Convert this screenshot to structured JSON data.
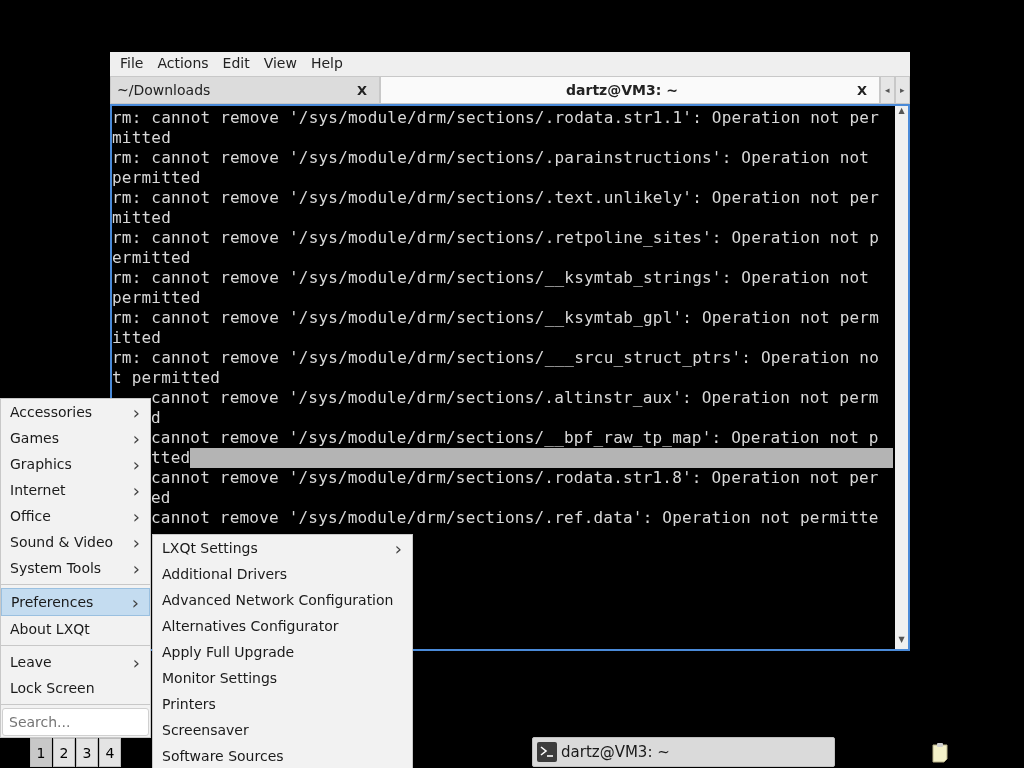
{
  "terminal": {
    "menu_bar": [
      "File",
      "Actions",
      "Edit",
      "View",
      "Help"
    ],
    "tabs": [
      {
        "label": "~/Downloads",
        "close": "X",
        "selected": false
      },
      {
        "label": "dartz@VM3: ~",
        "close": "X",
        "selected": true
      }
    ],
    "tab_scroll": [
      "◂",
      "▸"
    ],
    "lines": [
      {
        "text": "rm: cannot remove '/sys/module/drm/sections/.rodata.str1.1': Operation not per",
        "covered": false
      },
      {
        "text": "mitted",
        "covered": false
      },
      {
        "text": "rm: cannot remove '/sys/module/drm/sections/.parainstructions': Operation not",
        "covered": false
      },
      {
        "text": "permitted",
        "covered": false
      },
      {
        "text": "rm: cannot remove '/sys/module/drm/sections/.text.unlikely': Operation not per",
        "covered": false
      },
      {
        "text": "mitted",
        "covered": false
      },
      {
        "text": "rm: cannot remove '/sys/module/drm/sections/.retpoline_sites': Operation not p",
        "covered": false
      },
      {
        "text": "ermitted",
        "covered": false
      },
      {
        "text": "rm: cannot remove '/sys/module/drm/sections/__ksymtab_strings': Operation not",
        "covered": false
      },
      {
        "text": "permitted",
        "covered": false
      },
      {
        "text": "rm: cannot remove '/sys/module/drm/sections/__ksymtab_gpl': Operation not perm",
        "covered": false
      },
      {
        "text": "itted",
        "covered": false
      },
      {
        "text": "rm: cannot remove '/sys/module/drm/sections/___srcu_struct_ptrs': Operation no",
        "covered": false
      },
      {
        "text": "t permitted",
        "covered": false
      },
      {
        "text": "cannot remove '/sys/module/drm/sections/.altinstr_aux': Operation not perm",
        "covered": true
      },
      {
        "text": "d",
        "covered": true
      },
      {
        "text": "cannot remove '/sys/module/drm/sections/__bpf_raw_tp_map': Operation not p",
        "covered": true
      },
      {
        "text": "tted",
        "covered": true,
        "highlighted": true
      },
      {
        "text": "cannot remove '/sys/module/drm/sections/.rodata.str1.8': Operation not per",
        "covered": true
      },
      {
        "text": "ed",
        "covered": true
      },
      {
        "text": "cannot remove '/sys/module/drm/sections/.ref.data': Operation not permitte",
        "covered": true
      }
    ],
    "scroll_arrows": [
      "▲",
      "▼"
    ]
  },
  "main_menu": {
    "items": [
      {
        "label": "Accessories",
        "submenu": true,
        "selected": false
      },
      {
        "label": "Games",
        "submenu": true,
        "selected": false
      },
      {
        "label": "Graphics",
        "submenu": true,
        "selected": false
      },
      {
        "label": "Internet",
        "submenu": true,
        "selected": false
      },
      {
        "label": "Office",
        "submenu": true,
        "selected": false
      },
      {
        "label": "Sound & Video",
        "submenu": true,
        "selected": false
      },
      {
        "label": "System Tools",
        "submenu": true,
        "selected": false,
        "separator_after": true
      },
      {
        "label": "Preferences",
        "submenu": true,
        "selected": true
      },
      {
        "label": "About LXQt",
        "submenu": false,
        "selected": false,
        "separator_after": true
      },
      {
        "label": "Leave",
        "submenu": true,
        "selected": false
      },
      {
        "label": "Lock Screen",
        "submenu": false,
        "selected": false,
        "separator_after": true
      }
    ],
    "arrow": "›",
    "search": {
      "placeholder": "Search..."
    }
  },
  "submenu": {
    "items": [
      {
        "label": "LXQt Settings",
        "submenu": true
      },
      {
        "label": "Additional Drivers",
        "submenu": false
      },
      {
        "label": "Advanced Network Configuration",
        "submenu": false
      },
      {
        "label": "Alternatives Configurator",
        "submenu": false
      },
      {
        "label": "Apply Full Upgrade",
        "submenu": false
      },
      {
        "label": "Monitor Settings",
        "submenu": false
      },
      {
        "label": "Printers",
        "submenu": false
      },
      {
        "label": "Screensaver",
        "submenu": false
      },
      {
        "label": "Software Sources",
        "submenu": false
      }
    ]
  },
  "taskbar": {
    "desktops": [
      {
        "label": "1",
        "selected": true
      },
      {
        "label": "2",
        "selected": false
      },
      {
        "label": "3",
        "selected": false
      },
      {
        "label": "4",
        "selected": false
      }
    ],
    "task": {
      "label": "dartz@VM3: ~"
    }
  }
}
